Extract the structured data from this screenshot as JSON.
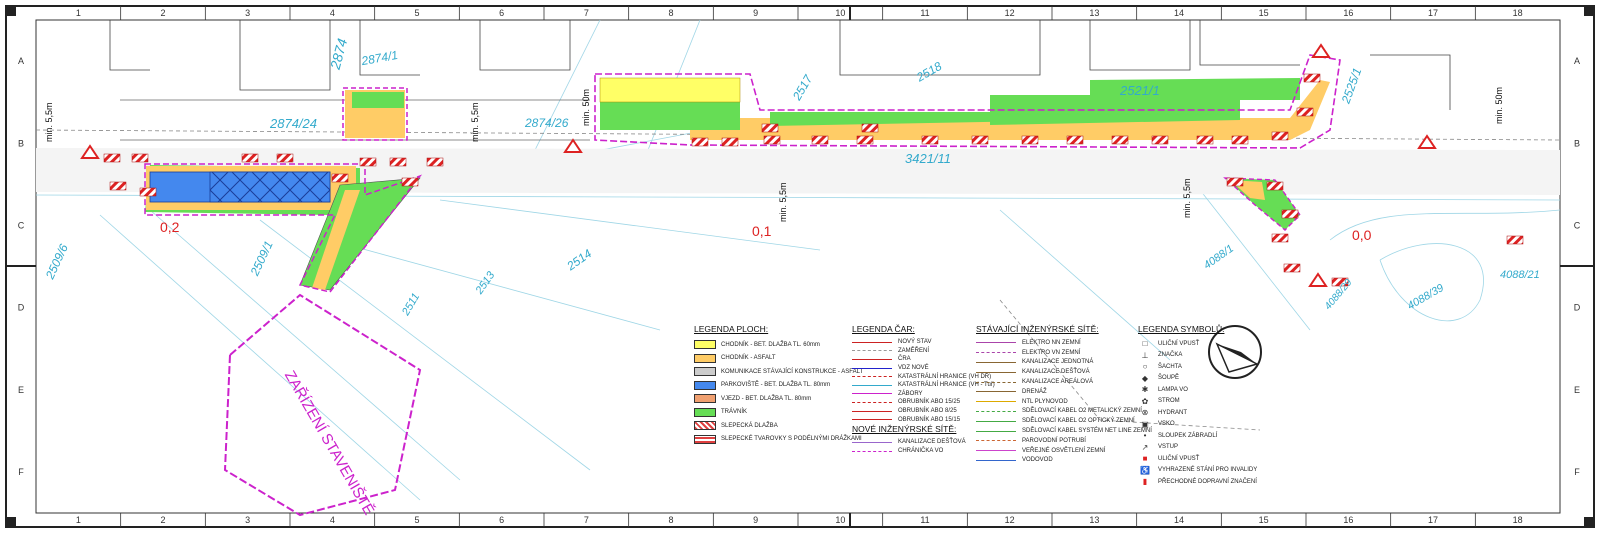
{
  "frame": {
    "columns": [
      "1",
      "2",
      "3",
      "4",
      "5",
      "6",
      "7",
      "8",
      "9",
      "10",
      "11",
      "12",
      "13",
      "14",
      "15",
      "16",
      "17",
      "18"
    ],
    "rows": [
      "A",
      "B",
      "C",
      "D",
      "E",
      "F"
    ]
  },
  "parcels": {
    "p2874": "2874",
    "p2874_1": "2874/1",
    "p2874_24": "2874/24",
    "p2874_26": "2874/26",
    "p2517": "2517",
    "p2518": "2518",
    "p2521_1": "2521/1",
    "p2525_1": "2525/1",
    "p3421_11": "3421/11",
    "p2509_1": "2509/1",
    "p2509_6": "2509/6",
    "p2513": "2513",
    "p2514": "2514",
    "p2511": "2511",
    "p4088_1": "4088/1",
    "p4088_39": "4088/39",
    "p4088_21": "4088/21",
    "p4088_29": "4088/29"
  },
  "annotations": {
    "min55_a": "min. 5,5m",
    "min55_b": "min. 5,5m",
    "min55_c": "min. 5,5m",
    "min55_d": "min. 5,5m",
    "min50_a": "min. 50m",
    "min50_b": "min. 50m",
    "level_02": "0,2",
    "level_01": "0,1",
    "level_00": "0,0",
    "site": "ZAŘÍZENÍ STAVENIŠTĚ"
  },
  "legend_plochy": {
    "title": "LEGENDA PLOCH:",
    "items": [
      {
        "label": "CHODNÍK - BET. DLAŽBA TL. 60mm",
        "color": "#ffff66"
      },
      {
        "label": "CHODNÍK - ASFALT",
        "color": "#ffcc66"
      },
      {
        "label": "KOMUNIKACE STÁVAJÍCÍ KONSTRUKCE - ASFALT",
        "color": "#cccccc"
      },
      {
        "label": "PARKOVIŠTĚ - BET. DLAŽBA TL. 80mm",
        "color": "#4488ee"
      },
      {
        "label": "VJEZD - BET. DLAŽBA TL. 80mm",
        "color": "#f0a070"
      },
      {
        "label": "TRÁVNÍK",
        "color": "#66dd55"
      },
      {
        "label": "SLEPECKÁ DLAŽBA",
        "color": "#e04040"
      },
      {
        "label": "SLEPECKÉ TVAROVKY S PODÉLNÝMI DRÁŽKAMI",
        "color": "#ffffff"
      }
    ]
  },
  "legend_car": {
    "title": "LEGENDA ČAR:",
    "items": [
      {
        "label": "NOVÝ STAV",
        "color": "#cc2222"
      },
      {
        "label": "ZAMĚŘENÍ",
        "color": "#999999"
      },
      {
        "label": "ČRA",
        "color": "#cc2222"
      },
      {
        "label": "VDZ NOVÉ",
        "color": "#2222cc"
      },
      {
        "label": "KATASTRÁLNÍ HRANICE (VH DŘ)",
        "color": "#cc2222"
      },
      {
        "label": "KATASTRÁLNÍ HRANICE (VH - Tuř)",
        "color": "#33aacc"
      },
      {
        "label": "ZÁBORY",
        "color": "#cc22cc"
      },
      {
        "label": "OBRUBNÍK ABO 15/25",
        "color": "#cc2222"
      },
      {
        "label": "OBRUBNÍK ABO 8/25",
        "color": "#cc2222"
      },
      {
        "label": "OBRUBNÍK ABO 15/15",
        "color": "#cc2222"
      }
    ]
  },
  "legend_nove_site": {
    "title": "NOVÉ INŽENÝRSKÉ SÍTĚ:",
    "items": [
      {
        "label": "KANALIZACE DEŠŤOVÁ",
        "color": "#9966cc"
      },
      {
        "label": "CHRÁNIČKA VO",
        "color": "#cc22cc"
      }
    ]
  },
  "legend_stavajici": {
    "title": "STÁVAJÍCÍ INŽENÝRSKÉ SÍTĚ:",
    "items": [
      {
        "label": "ELEKTRO NN ZEMNÍ",
        "color": "#aa44aa"
      },
      {
        "label": "ELEKTRO VN ZEMNÍ",
        "color": "#aa44aa"
      },
      {
        "label": "KANALIZACE JEDNOTNÁ",
        "color": "#886633"
      },
      {
        "label": "KANALIZACE DEŠŤOVÁ",
        "color": "#886633"
      },
      {
        "label": "KANALIZACE AREÁLOVÁ",
        "color": "#886633"
      },
      {
        "label": "DRENÁŽ",
        "color": "#886633"
      },
      {
        "label": "NTL PLYNOVOD",
        "color": "#ddaa00"
      },
      {
        "label": "SDĚLOVACÍ KABEL O2 METALICKÝ ZEMNÍ",
        "color": "#44aa44"
      },
      {
        "label": "SDĚLOVACÍ KABEL O2 OPTICKÝ ZEMNÍ",
        "color": "#44aa44"
      },
      {
        "label": "SDĚLOVACÍ KABEL SYSTÉM NET LINE ZEMNÍ",
        "color": "#44aa44"
      },
      {
        "label": "PAROVODNÍ POTRUBÍ",
        "color": "#cc6633"
      },
      {
        "label": "VEŘEJNÉ OSVĚTLENÍ ZEMNÍ",
        "color": "#cc44cc"
      },
      {
        "label": "VODOVOD",
        "color": "#3366cc"
      }
    ]
  },
  "legend_symbolu": {
    "title": "LEGENDA SYMBOLŮ:",
    "items": [
      {
        "label": "ULIČNÍ VPUSŤ",
        "icon": "□"
      },
      {
        "label": "ZNAČKA",
        "icon": "⊥"
      },
      {
        "label": "ŠACHTA",
        "icon": "○"
      },
      {
        "label": "ŠOUPĚ",
        "icon": "◆"
      },
      {
        "label": "LAMPA VO",
        "icon": "✱"
      },
      {
        "label": "STROM",
        "icon": "✿"
      },
      {
        "label": "HYDRANT",
        "icon": "⊗"
      },
      {
        "label": "VSKO",
        "icon": "▣"
      },
      {
        "label": "SLOUPEK ZÁBRADLÍ",
        "icon": "•"
      },
      {
        "label": "VSTUP",
        "icon": "↗"
      },
      {
        "label": "ULIČNÍ VPUSŤ",
        "icon": "■"
      },
      {
        "label": "VYHRAZENÉ STÁNÍ PRO INVALIDY",
        "icon": "♿"
      },
      {
        "label": "PŘECHODNÉ DOPRAVNÍ ZNAČENÍ",
        "icon": "▮"
      }
    ]
  }
}
